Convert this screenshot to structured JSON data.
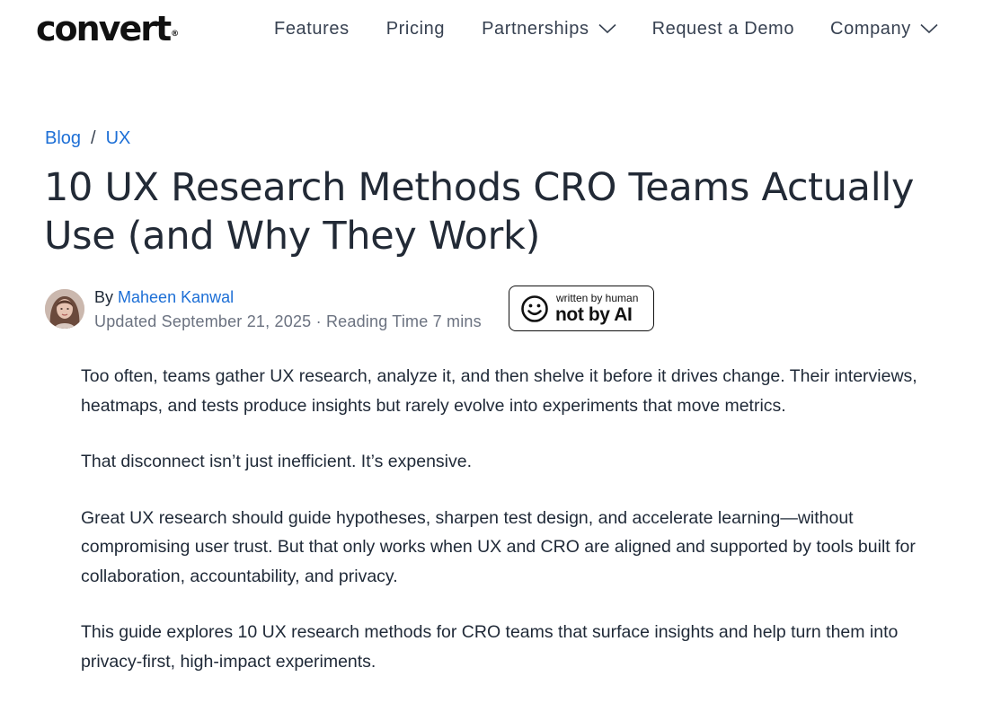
{
  "header": {
    "logo_text": "convert",
    "logo_mark": "®",
    "nav": {
      "features": "Features",
      "pricing": "Pricing",
      "partnerships": "Partnerships",
      "demo": "Request a Demo",
      "company": "Company"
    }
  },
  "breadcrumb": {
    "blog": "Blog",
    "separator": "/",
    "category": "UX"
  },
  "article": {
    "title": "10 UX Research Methods CRO Teams Actually Use (and Why They Work)",
    "by": "By",
    "author": "Maheen Kanwal",
    "meta": "Updated September 21, 2025 · Reading Time 7 mins",
    "badge": {
      "small": "written by human",
      "big": "not by AI",
      "icon": "smiley-face-icon"
    },
    "paragraphs": [
      "Too often, teams gather UX research, analyze it, and then shelve it before it drives change. Their interviews, heatmaps, and tests produce insights but rarely evolve into experiments that move metrics.",
      "That disconnect isn’t just inefficient. It’s expensive.",
      "Great UX research should guide hypotheses, sharpen test design, and accelerate learning—without compromising user trust. But that only works when UX and CRO are aligned and supported by tools built for collaboration, accountability, and privacy.",
      "This guide explores 10 UX research methods for CRO teams that surface insights and help turn them into privacy-first, high-impact experiments."
    ]
  },
  "colors": {
    "link": "#1d6fd6",
    "text": "#1f2937",
    "muted": "#6b7280",
    "title": "#222a36"
  }
}
